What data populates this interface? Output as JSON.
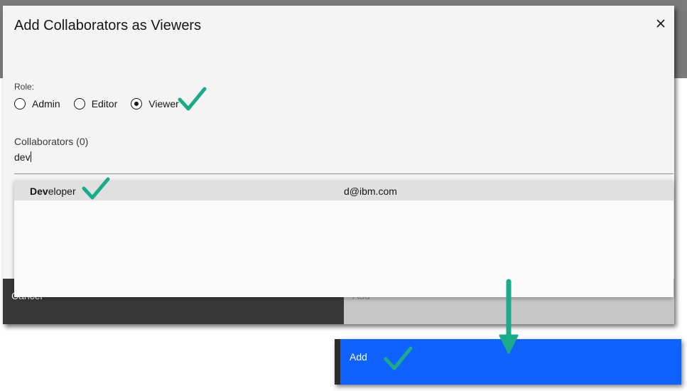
{
  "dialog": {
    "title": "Add Collaborators as Viewers",
    "close_icon": "close-icon"
  },
  "role": {
    "label": "Role:",
    "options": [
      {
        "label": "Admin",
        "checked": false
      },
      {
        "label": "Editor",
        "checked": false
      },
      {
        "label": "Viewer",
        "checked": true
      }
    ]
  },
  "collaborators": {
    "label": "Collaborators (0)",
    "input_value": "dev"
  },
  "dropdown": {
    "items": [
      {
        "name_match": "Dev",
        "name_rest": "eloper",
        "email": "d@ibm.com"
      }
    ]
  },
  "footer": {
    "cancel_label": "Cancel",
    "add_label": "Add"
  },
  "callout": {
    "add_label": "Add"
  },
  "annotations": {
    "check_icon": "check-icon",
    "arrow_icon": "arrow-down-icon",
    "accent_color": "#1aab8a",
    "primary_color": "#0f62fe"
  }
}
